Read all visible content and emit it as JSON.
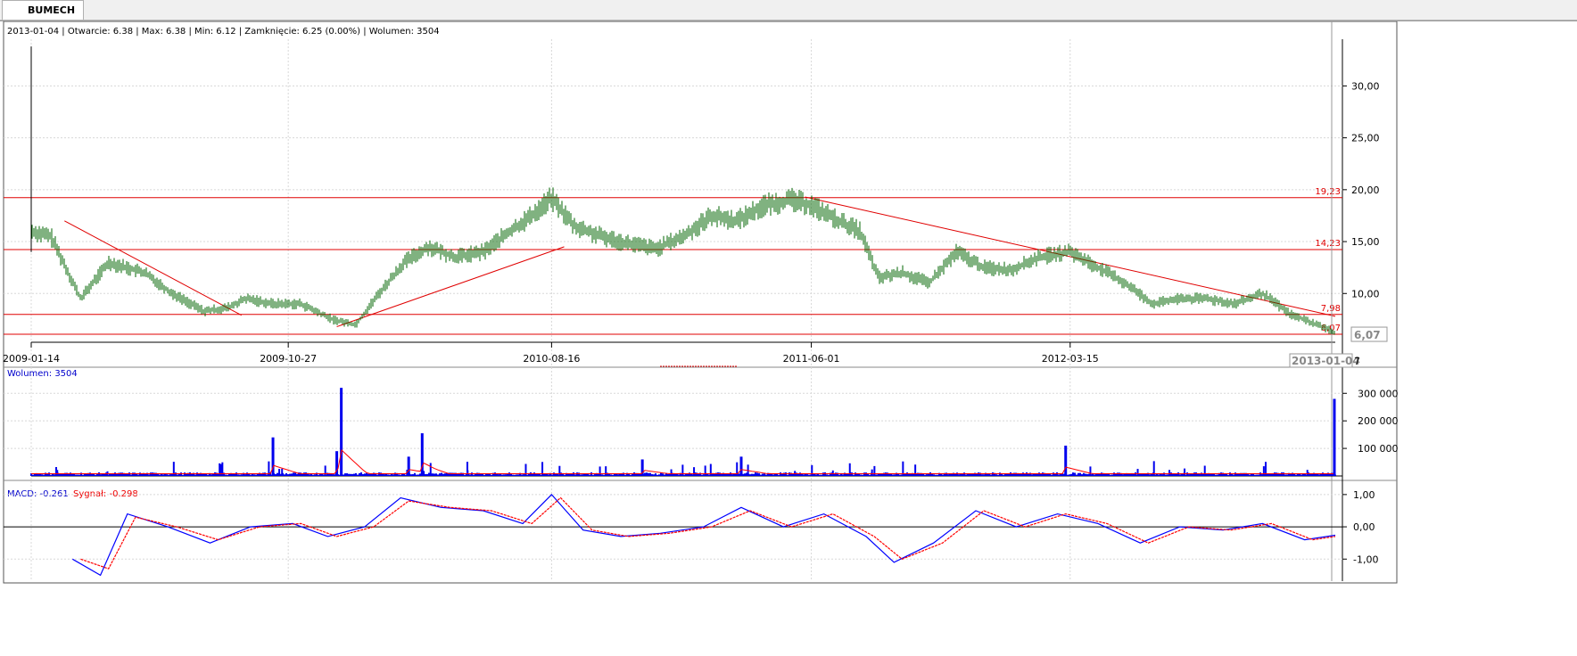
{
  "tab": {
    "label": "BUMECH"
  },
  "info_line": "2013-01-04 | Otwarcie: 6.38 | Max: 6.38 | Min: 6.12 | Zamknięcie: 6.25 (0.00%)  | Wolumen: 3504",
  "volume_label": "Wolumen: 3504",
  "macd_label": {
    "macd": "MACD: -0.261",
    "signal": "Sygnał: -0.298"
  },
  "current_price_label": "6,07",
  "current_date_label": "2013-01-04",
  "date_tick_cut": "7",
  "colors": {
    "candle": "#006400",
    "hline": "#e00000",
    "volume": "#0000ee",
    "volume_avg": "#ff0000",
    "macd": "#0000ff",
    "signal": "#ff0000",
    "grid": "#d8d8d8"
  },
  "chart_data": [
    {
      "type": "candlestick",
      "title": "BUMECH",
      "x_ticks": [
        "2009-01-14",
        "2009-10-27",
        "2010-08-16",
        "2011-06-01",
        "2012-03-15"
      ],
      "y_ticks": [
        "30,00",
        "25,00",
        "20,00",
        "15,00",
        "10,00"
      ],
      "ylim": [
        5.3,
        34.5
      ],
      "grid": true,
      "horizontal_levels": [
        {
          "value": 19.23,
          "label": "19,23"
        },
        {
          "value": 14.23,
          "label": "14,23"
        },
        {
          "value": 7.98,
          "label": "7,98"
        },
        {
          "value": 6.07,
          "label": "6,07"
        }
      ],
      "trendlines": [
        {
          "from": [
            "2009-02-20",
            17.0
          ],
          "to": [
            "2009-09-05",
            7.9
          ]
        },
        {
          "from": [
            "2009-12-20",
            6.8
          ],
          "to": [
            "2010-08-30",
            14.5
          ]
        },
        {
          "from": [
            "2011-05-25",
            19.3
          ],
          "to": [
            "2013-01-04",
            7.8
          ]
        }
      ],
      "series": [
        {
          "name": "BUMECH",
          "x": [
            "2009-01-14",
            "2009-02-05",
            "2009-03-10",
            "2009-04-10",
            "2009-05-20",
            "2009-06-20",
            "2009-07-25",
            "2009-08-20",
            "2009-09-10",
            "2009-10-10",
            "2009-11-10",
            "2009-12-15",
            "2010-01-10",
            "2010-02-05",
            "2010-03-05",
            "2010-04-01",
            "2010-05-01",
            "2010-06-01",
            "2010-07-01",
            "2010-07-25",
            "2010-08-16",
            "2010-09-10",
            "2010-10-10",
            "2010-11-10",
            "2010-12-10",
            "2011-01-10",
            "2011-02-10",
            "2011-03-10",
            "2011-04-10",
            "2011-05-10",
            "2011-06-01",
            "2011-07-01",
            "2011-07-25",
            "2011-08-15",
            "2011-09-10",
            "2011-10-10",
            "2011-11-10",
            "2011-12-10",
            "2012-01-10",
            "2012-02-10",
            "2012-03-15",
            "2012-04-15",
            "2012-05-15",
            "2012-06-15",
            "2012-07-15",
            "2012-08-15",
            "2012-09-15",
            "2012-10-15",
            "2012-11-15",
            "2012-12-15",
            "2013-01-04"
          ],
          "close": [
            16.0,
            15.5,
            9.5,
            13.0,
            12.0,
            10.0,
            8.3,
            8.6,
            9.5,
            9.0,
            9.0,
            7.5,
            7.0,
            10.0,
            13.0,
            14.5,
            13.5,
            14.0,
            16.0,
            17.5,
            19.2,
            16.5,
            15.5,
            14.8,
            14.3,
            15.5,
            17.5,
            17.0,
            18.5,
            19.0,
            18.5,
            17.0,
            16.0,
            11.5,
            12.0,
            11.0,
            14.0,
            12.5,
            12.3,
            13.5,
            14.0,
            12.5,
            11.0,
            9.0,
            9.5,
            9.5,
            9.0,
            10.0,
            8.0,
            7.0,
            6.25
          ]
        }
      ]
    },
    {
      "type": "bar",
      "title": "Wolumen",
      "y_ticks": [
        "300 000",
        "200 000",
        "100 000"
      ],
      "ylim": [
        0,
        330000
      ],
      "series": [
        {
          "name": "Wolumen",
          "spikes": [
            {
              "x": "2009-10-10",
              "value": 140000
            },
            {
              "x": "2009-12-25",
              "value": 320000
            },
            {
              "x": "2009-12-20",
              "value": 90000
            },
            {
              "x": "2010-03-25",
              "value": 155000
            },
            {
              "x": "2010-03-10",
              "value": 70000
            },
            {
              "x": "2010-11-25",
              "value": 60000
            },
            {
              "x": "2011-03-15",
              "value": 70000
            },
            {
              "x": "2012-03-10",
              "value": 110000
            },
            {
              "x": "2013-01-03",
              "value": 280000
            }
          ]
        },
        {
          "name": "Wolumen MA",
          "values": []
        }
      ]
    },
    {
      "type": "line",
      "title": "MACD",
      "y_ticks": [
        "1,00",
        "0,00",
        "-1,00"
      ],
      "ylim": [
        -1.6,
        1.3
      ],
      "series": [
        {
          "name": "MACD",
          "x": [
            "2009-03-01",
            "2009-04-01",
            "2009-05-01",
            "2009-06-15",
            "2009-08-01",
            "2009-09-15",
            "2009-11-01",
            "2009-12-10",
            "2010-01-20",
            "2010-03-01",
            "2010-04-15",
            "2010-06-01",
            "2010-07-15",
            "2010-08-16",
            "2010-09-20",
            "2010-11-01",
            "2010-12-15",
            "2011-02-01",
            "2011-03-15",
            "2011-05-01",
            "2011-06-15",
            "2011-08-01",
            "2011-09-01",
            "2011-10-15",
            "2011-12-01",
            "2012-01-15",
            "2012-03-01",
            "2012-04-15",
            "2012-06-01",
            "2012-07-15",
            "2012-09-01",
            "2012-10-15",
            "2012-12-01",
            "2013-01-04"
          ],
          "values": [
            -1.0,
            -1.5,
            0.4,
            0.0,
            -0.5,
            0.0,
            0.1,
            -0.3,
            0.0,
            0.9,
            0.6,
            0.5,
            0.1,
            1.0,
            -0.1,
            -0.3,
            -0.2,
            0.0,
            0.6,
            0.0,
            0.4,
            -0.3,
            -1.1,
            -0.5,
            0.5,
            0.0,
            0.4,
            0.1,
            -0.5,
            0.0,
            -0.1,
            0.1,
            -0.4,
            -0.26
          ]
        },
        {
          "name": "Sygnał",
          "x": [
            "2009-03-10",
            "2009-04-10",
            "2009-05-10",
            "2009-06-25",
            "2009-08-10",
            "2009-09-25",
            "2009-11-10",
            "2009-12-20",
            "2010-01-30",
            "2010-03-10",
            "2010-04-25",
            "2010-06-10",
            "2010-07-25",
            "2010-08-26",
            "2010-09-30",
            "2010-11-10",
            "2010-12-25",
            "2011-02-10",
            "2011-03-25",
            "2011-05-10",
            "2011-06-25",
            "2011-08-10",
            "2011-09-10",
            "2011-10-25",
            "2011-12-10",
            "2012-01-25",
            "2012-03-10",
            "2012-04-25",
            "2012-06-10",
            "2012-07-25",
            "2012-09-10",
            "2012-10-25",
            "2012-12-10",
            "2013-01-04"
          ],
          "values": [
            -1.0,
            -1.3,
            0.3,
            0.0,
            -0.4,
            0.0,
            0.1,
            -0.3,
            0.0,
            0.8,
            0.6,
            0.5,
            0.1,
            0.9,
            -0.1,
            -0.3,
            -0.2,
            0.0,
            0.5,
            0.0,
            0.4,
            -0.3,
            -1.0,
            -0.5,
            0.5,
            0.0,
            0.4,
            0.1,
            -0.5,
            0.0,
            -0.1,
            0.1,
            -0.4,
            -0.3
          ]
        }
      ]
    }
  ]
}
